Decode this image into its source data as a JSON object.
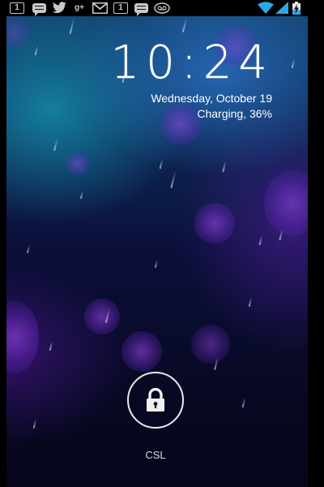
{
  "status_bar": {
    "notification_icons": [
      {
        "name": "missed-call-count-icon",
        "text": "1"
      },
      {
        "name": "sms-icon"
      },
      {
        "name": "twitter-icon"
      },
      {
        "name": "google-plus-icon",
        "text": "g+"
      },
      {
        "name": "gmail-icon"
      },
      {
        "name": "missed-call-count-icon",
        "text": "1"
      },
      {
        "name": "sms-icon"
      },
      {
        "name": "voicemail-icon"
      }
    ],
    "system_icons": [
      "wifi-icon",
      "cell-signal-icon",
      "battery-charging-icon"
    ],
    "colors": {
      "icon": "#c8c8c8"
    }
  },
  "lockscreen": {
    "time": "10:24",
    "date": "Wednesday, October 19",
    "charging": "Charging, 36%",
    "carrier": "CSL",
    "unlock_icon": "padlock-icon"
  }
}
